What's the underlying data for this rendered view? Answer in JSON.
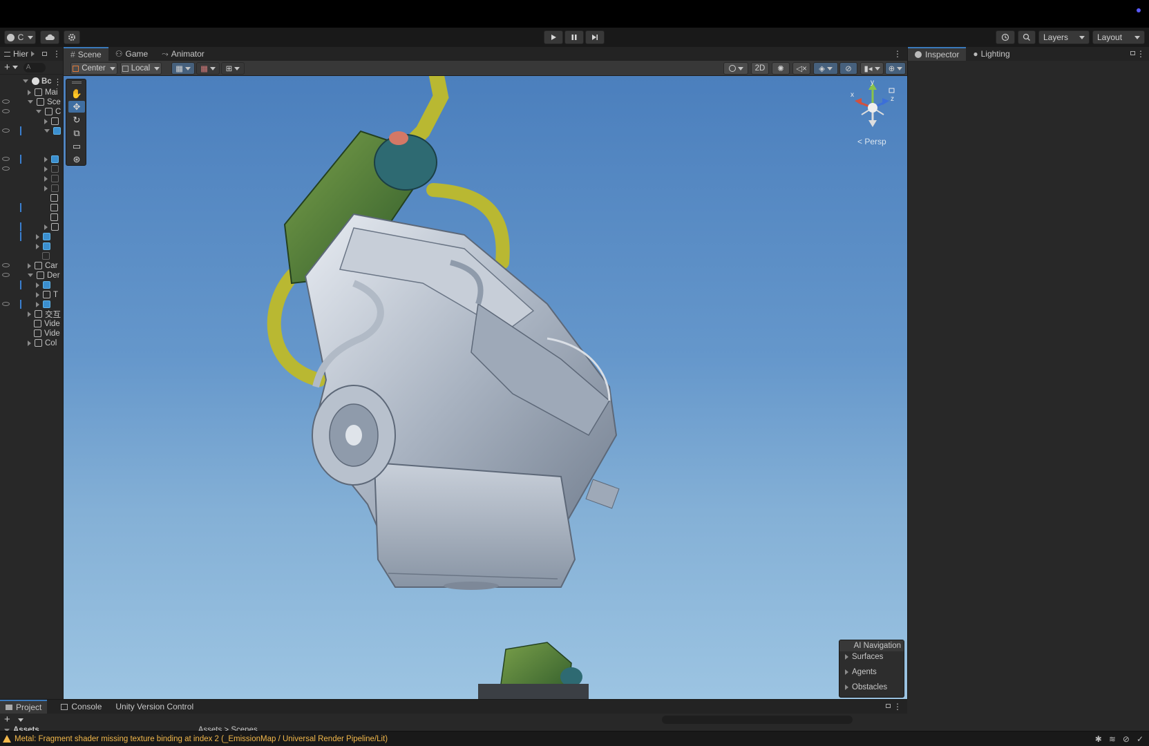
{
  "toolbar": {
    "account_label": "C",
    "play_icon": "play-icon",
    "pause_icon": "pause-icon",
    "step_icon": "step-icon",
    "layers_label": "Layers",
    "layout_label": "Layout"
  },
  "hierarchy": {
    "tab_label": "Hier",
    "search_placeholder": "A",
    "root_label": "Bc",
    "items": [
      {
        "label": "Mai",
        "depth": 1,
        "arrow": "closed",
        "icon": "cube"
      },
      {
        "label": "Sce",
        "depth": 1,
        "arrow": "open",
        "icon": "cube"
      },
      {
        "label": "C",
        "depth": 2,
        "arrow": "open",
        "icon": "cube"
      },
      {
        "label": "",
        "depth": 3,
        "arrow": "closed",
        "icon": "cube"
      },
      {
        "label": "",
        "depth": 3,
        "arrow": "open",
        "icon": "cube-blue"
      },
      {
        "label": "",
        "depth": 3,
        "arrow": "closed",
        "icon": "cube-blue"
      },
      {
        "label": "",
        "depth": 3,
        "arrow": "closed",
        "icon": "cube-dim"
      },
      {
        "label": "",
        "depth": 3,
        "arrow": "closed",
        "icon": "cube-dim"
      },
      {
        "label": "",
        "depth": 3,
        "arrow": "closed",
        "icon": "cube-dim"
      },
      {
        "label": "",
        "depth": 3,
        "arrow": "none",
        "icon": "cube"
      },
      {
        "label": "",
        "depth": 3,
        "arrow": "none",
        "icon": "cube"
      },
      {
        "label": "",
        "depth": 3,
        "arrow": "none",
        "icon": "cube"
      },
      {
        "label": "",
        "depth": 3,
        "arrow": "closed",
        "icon": "cube"
      },
      {
        "label": "",
        "depth": 2,
        "arrow": "closed",
        "icon": "cube-blue"
      },
      {
        "label": "",
        "depth": 2,
        "arrow": "closed",
        "icon": "cube-blue"
      },
      {
        "label": "",
        "depth": 2,
        "arrow": "none",
        "icon": "cube-dim"
      },
      {
        "label": "Car",
        "depth": 1,
        "arrow": "closed",
        "icon": "cube"
      },
      {
        "label": "Der",
        "depth": 1,
        "arrow": "open",
        "icon": "cube"
      },
      {
        "label": "",
        "depth": 2,
        "arrow": "closed",
        "icon": "cube-blue"
      },
      {
        "label": "T",
        "depth": 2,
        "arrow": "closed",
        "icon": "cube"
      },
      {
        "label": "",
        "depth": 2,
        "arrow": "closed",
        "icon": "cube-blue"
      },
      {
        "label": "交互",
        "depth": 1,
        "arrow": "closed",
        "icon": "cube"
      },
      {
        "label": "Vide",
        "depth": 1,
        "arrow": "none",
        "icon": "cube"
      },
      {
        "label": "Vide",
        "depth": 1,
        "arrow": "none",
        "icon": "cube"
      },
      {
        "label": "Col",
        "depth": 1,
        "arrow": "closed",
        "icon": "cube"
      }
    ]
  },
  "scene": {
    "tabs": [
      "Scene",
      "Game",
      "Animator"
    ],
    "pivot_label": "Center",
    "space_label": "Local",
    "mode_2d": "2D",
    "persp_label": "< Persp",
    "axis_labels": {
      "x": "x",
      "y": "y",
      "z": "z"
    },
    "ai_navigation": {
      "title": "AI Navigation",
      "items": [
        "Surfaces",
        "Agents",
        "Obstacles"
      ]
    }
  },
  "inspector": {
    "tabs": [
      "Inspector",
      "Lighting"
    ]
  },
  "bottom": {
    "tabs": [
      "Project",
      "Console",
      "Unity Version Control"
    ],
    "assets_label": "Assets",
    "breadcrumb": "Assets > Scenes"
  },
  "status": {
    "message": "Metal: Fragment shader missing texture binding at index 2 (_EmissionMap / Universal Render Pipeline/Lit)"
  },
  "colors": {
    "accent": "#3a79bb",
    "warning": "#f2b84b",
    "sky_top": "#4b7fbd",
    "sky_bottom": "#9cc4e2",
    "hose": "#b9b832",
    "filter_green": "#4f7a36"
  }
}
